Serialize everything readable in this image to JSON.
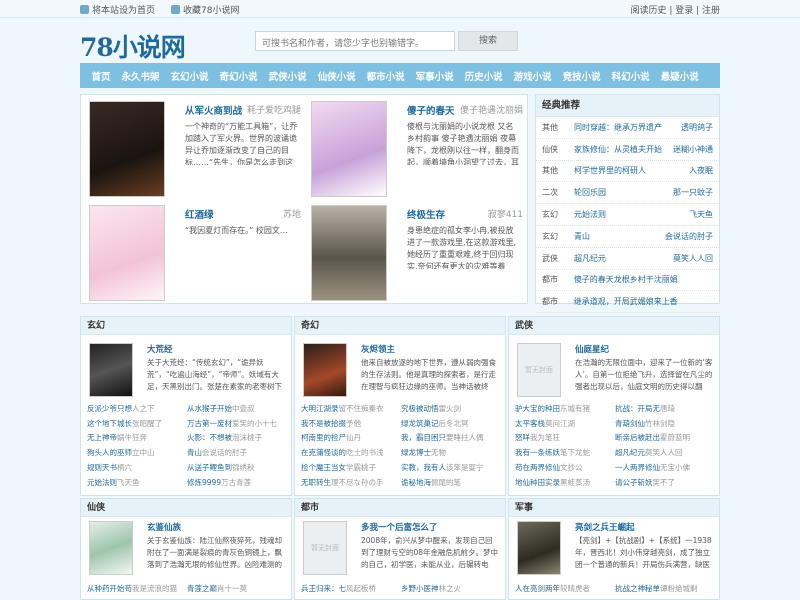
{
  "topbar": {
    "left": [
      "将本站设为首页",
      "收藏78小说网"
    ],
    "right": "阅读历史 | 登录 | 注册"
  },
  "logo": "78小说网",
  "search": {
    "placeholder": "可搜书名和作者，请您少字也别输错字。",
    "button": "搜索"
  },
  "nav": [
    "首页",
    "永久书架",
    "玄幻小说",
    "奇幻小说",
    "武侠小说",
    "仙侠小说",
    "都市小说",
    "军事小说",
    "历史小说",
    "游戏小说",
    "竞技小说",
    "科幻小说",
    "悬疑小说"
  ],
  "featured": [
    {
      "title": "从军火商到战",
      "author": "耗子爱吃鸡腿",
      "desc": "一个神奇的“万能工具箱”，让乔加踏入了军火界。世界的波谲诡异让乔加逐渐改变了自己的目标……“先生，你是怎么走到这一"
    },
    {
      "title": "傻子的春天",
      "author": "傻子艳遇沈丽娟",
      "desc": "傻根与沈丽娟的小说龙根 又名 乡村韵事 傻子艳遇沈丽娟 夜幕降下，龙根刚以往一样，翻身而起，顺着墙角小洞望了过去，耳边"
    },
    {
      "title": "红酒绿",
      "author": "苏地",
      "desc": "“我因夏灯而存在。” 校园文…"
    },
    {
      "title": "终极生存",
      "author": "寂寥411",
      "desc": "身患绝症的孤女李小冉,被投放进了一款游戏里,在这款游戏里,她经历了重重艰难,终于回归现实,奈何还有更大的灾难等着她。…"
    }
  ],
  "recommend": {
    "title": "经典推荐",
    "rows": [
      {
        "cat": "其他",
        "book": "同时穿越：继承万界遗产",
        "author": "透明鸽子"
      },
      {
        "cat": "仙侠",
        "book": "家族修仙：从灵植夫开始",
        "author": "迷糊小神通"
      },
      {
        "cat": "其他",
        "book": "柯学世界里的柯研人",
        "author": "入夜眠"
      },
      {
        "cat": "二次",
        "book": "轮回乐园",
        "author": "那一只蚊子"
      },
      {
        "cat": "玄幻",
        "book": "元始法则",
        "author": "飞天鱼"
      },
      {
        "cat": "玄幻",
        "book": "青山",
        "author": "会说话的肘子"
      },
      {
        "cat": "武侠",
        "book": "超凡纪元",
        "author": "莫笑人人回"
      },
      {
        "cat": "都市",
        "book": "傻子的春天龙根乡村干沈丽娟",
        "author": ""
      },
      {
        "cat": "都市",
        "book": "继承道观，开局武媚娘来上香",
        "author": ""
      }
    ]
  },
  "sections": [
    {
      "name": "玄幻",
      "title": "大荒经",
      "desc": "关于大荒经：“传统玄幻”，“诡异妖荒”，“吃遍山海经”，“帝师”。妖域有大足，天黑别出门。张楚在素家的老枣树下读，莫",
      "items": [
        [
          "反派少爷只想",
          "人之下"
        ],
        [
          "从水猴子开始",
          "中壹叔"
        ],
        [
          "这个地下城长",
          "张昭醒了"
        ],
        [
          "万古第一废材",
          "爱笑的小十七"
        ],
        [
          "无上神帝",
          "蜗牛狂奔"
        ],
        [
          "火影：不想被",
          "泡沫桃子"
        ],
        [
          "狗头人的巫师",
          "立中山"
        ],
        [
          "青山",
          "会说话的肘子"
        ],
        [
          "规则天书",
          "柄六"
        ],
        [
          "从送子鲤鱼到",
          "锦绣秋"
        ],
        [
          "元始法则",
          "飞天鱼"
        ],
        [
          "修炼9999",
          "万古青莲"
        ]
      ]
    },
    {
      "name": "奇幻",
      "title": "灰烬领主",
      "desc": "他来自被放逐的地下世界，遵从弱肉强食的生存法则。他是真理的探索者，是行走在理智与疯狂边缘的巫师。当神话被终",
      "items": [
        [
          "大明江湖录",
          "留不住痴秦衣"
        ],
        [
          "究极被动悟",
          "雷火剑"
        ],
        [
          "我不是被拾掇",
          "予他"
        ],
        [
          "绿龙筑巢记",
          "后冬北冥"
        ],
        [
          "柯南里的捡尸",
          "仙丹"
        ],
        [
          "我，霸目困只",
          "要睡拄人偶"
        ],
        [
          "在克蒲怪谈的",
          "吃土的书浅"
        ],
        [
          "绿龙博士",
          "无物"
        ],
        [
          "捡个魔王当女",
          "学霸桃子"
        ],
        [
          "实教，我有人",
          "该笨是婴宁"
        ],
        [
          "无职转生",
          "理不尽な孙の手"
        ],
        [
          "诡秘地海",
          "佩尾的笔"
        ]
      ]
    },
    {
      "name": "武侠",
      "title": "仙庭星纪",
      "desc": "在浩瀚的无限位面中，迎来了一位新的‘客人’。自第一位拒绝飞升，选择留在凡尘的强者出现以后，仙庭文明的历史得以翻",
      "items": [
        [
          "驴大宝的种田",
          "东城有猪"
        ],
        [
          "抗战：开局无",
          "唐琦"
        ],
        [
          "太平客栈",
          "莫问江湖"
        ],
        [
          "青葫剑仙",
          "竹林剑隐"
        ],
        [
          "怒咩",
          "我为笔狂"
        ],
        [
          "断亲后被赶出",
          "霍蔚蓝明"
        ],
        [
          "我有一条练妖",
          "笔下龙蛇"
        ],
        [
          "超凡纪元",
          "莫笑人人回"
        ],
        [
          "苟在两界修仙",
          "文抄公"
        ],
        [
          "一人两界修仙",
          "无宝小佛"
        ],
        [
          "地仙种田实录",
          "黑蛙蒸汤"
        ],
        [
          "请公子斩妖",
          "笑不了"
        ]
      ]
    },
    {
      "name": "仙侠",
      "title": "玄鉴仙族",
      "desc": "关于玄鉴仙族：陆江仙熬夜猝死，残魂却附在了一面满是裂痕的青灰色铜镜上，飘落到了浩瀚无垠的修仙世界。凶险难测的",
      "items": [
        [
          "从种药开始苟",
          "我是流浪的猫"
        ],
        [
          "青莲之巅",
          "肖十一莫"
        ]
      ]
    },
    {
      "name": "都市",
      "title": "多我一个后富怎么了",
      "desc": "2008年，俞兴从梦中醒来，发现自己回到了理财亏空的08年金融危机前夕。梦中的自己，初学医，未能从业，后辗转电视，遇",
      "items": [
        [
          "兵王归来：七",
          "风起板桥"
        ],
        [
          "乡野小医神",
          "林之火"
        ]
      ]
    },
    {
      "name": "军事",
      "title": "亮剑之兵王崛起",
      "desc": "【亮剑】+【抗战剧】+【系统】一1938年，晋西北！刘小伟穿越亮剑，成了独立团一个普通的新兵！开局伤兵满营，缺医",
      "items": [
        [
          "人在亮剑两年",
          "较晴虎者"
        ],
        [
          "抗战之神秘单",
          "谭粉绝城剿"
        ]
      ]
    }
  ]
}
